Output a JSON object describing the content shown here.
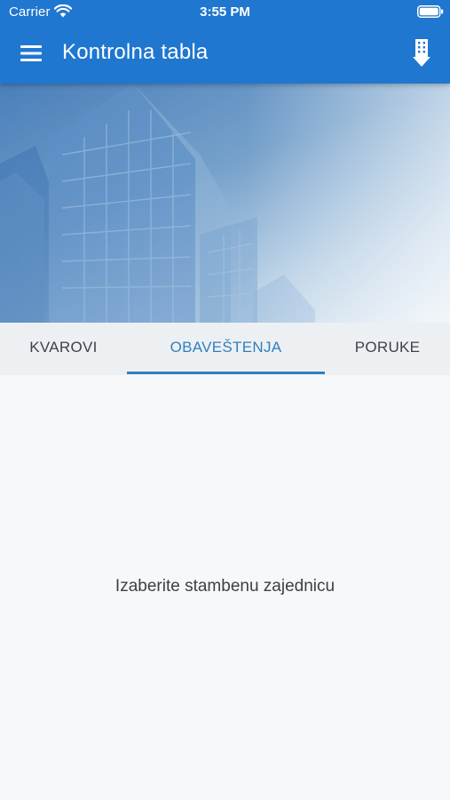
{
  "status_bar": {
    "carrier": "Carrier",
    "time": "3:55 PM"
  },
  "app_bar": {
    "title": "Kontrolna tabla",
    "menu_icon": "hamburger-menu-icon",
    "action_icon": "building-download-icon",
    "background_color": "#1f77cf"
  },
  "tabs": [
    {
      "label": "KVAROVI",
      "active": false
    },
    {
      "label": "OBAVEŠTENJA",
      "active": true
    },
    {
      "label": "PORUKE",
      "active": false
    }
  ],
  "accent_color": "#2f7fc1",
  "content": {
    "empty_message": "Izaberite stambenu zajednicu"
  }
}
